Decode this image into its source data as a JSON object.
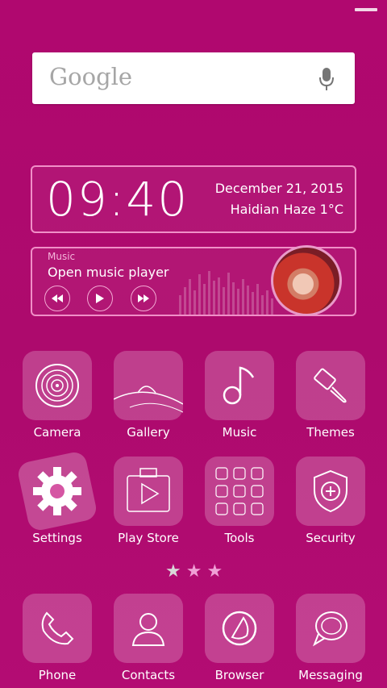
{
  "search": {
    "logo": "Google"
  },
  "clock": {
    "time": "09:40",
    "date": "December  21, 2015",
    "weather": "Haidian  Haze  1°C"
  },
  "music": {
    "tag": "Music",
    "title": "Open music player"
  },
  "apps": [
    {
      "label": "Camera"
    },
    {
      "label": "Gallery"
    },
    {
      "label": "Music"
    },
    {
      "label": "Themes"
    },
    {
      "label": "Settings"
    },
    {
      "label": "Play Store"
    },
    {
      "label": "Tools"
    },
    {
      "label": "Security"
    }
  ],
  "dock": [
    {
      "label": "Phone"
    },
    {
      "label": "Contacts"
    },
    {
      "label": "Browser"
    },
    {
      "label": "Messaging"
    }
  ],
  "page_dots": {
    "count": 3,
    "active_index": 0
  },
  "colors": {
    "background": "#b0086f",
    "accent_border": "#f08fc7",
    "text": "#ffffff"
  }
}
